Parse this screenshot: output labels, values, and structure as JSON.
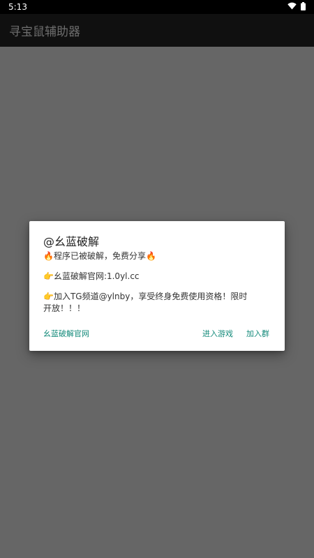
{
  "status_bar": {
    "time": "5:13",
    "wifi_icon": "wifi-icon",
    "battery_icon": "battery-icon"
  },
  "app_bar": {
    "title": "寻宝鼠辅助器"
  },
  "dialog": {
    "title": "@幺蓝破解",
    "lines": [
      "🔥程序已被破解，免费分享🔥",
      "👉幺蓝破解官网:1.0yl.cc",
      "👉加入TG频道@ylnby，享受终身免费使用资格！限时开放！！！"
    ],
    "actions": {
      "website_label": "幺蓝破解官网",
      "enter_game_label": "进入游戏",
      "join_group_label": "加入群"
    },
    "accent_color": "#138A7A"
  }
}
